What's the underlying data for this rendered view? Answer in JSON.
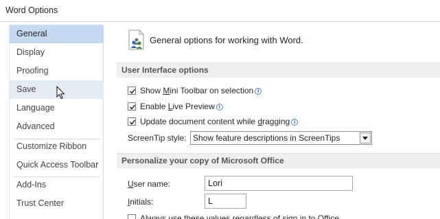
{
  "window": {
    "title": "Word Options"
  },
  "sidebar": {
    "items": [
      {
        "label": "General"
      },
      {
        "label": "Display"
      },
      {
        "label": "Proofing"
      },
      {
        "label": "Save"
      },
      {
        "label": "Language"
      },
      {
        "label": "Advanced"
      },
      {
        "label": "Customize Ribbon"
      },
      {
        "label": "Quick Access Toolbar"
      },
      {
        "label": "Add-Ins"
      },
      {
        "label": "Trust Center"
      }
    ],
    "selected": "General",
    "hovered": "Save"
  },
  "main": {
    "header": "General options for working with Word.",
    "ui_section": {
      "title": "User Interface options",
      "options": [
        {
          "pre": "Show ",
          "accel": "M",
          "post": "ini Toolbar on selection",
          "checked": true
        },
        {
          "pre": "Enable ",
          "accel": "L",
          "post": "ive Preview",
          "checked": true
        },
        {
          "pre": "Update document content while ",
          "accel": "d",
          "post": "ragging",
          "checked": true
        }
      ],
      "screentip": {
        "label": "ScreenTip style:",
        "value": "Show feature descriptions in ScreenTips"
      }
    },
    "personalize_section": {
      "title": "Personalize your copy of Microsoft Office",
      "username": {
        "pre": "",
        "accel": "U",
        "post": "ser name:",
        "value": "Lori"
      },
      "initials": {
        "pre": "",
        "accel": "I",
        "post": "nitials:",
        "value": "L"
      },
      "always_use": {
        "text": "Always use these values regardless of sign in to Office.",
        "checked": false
      }
    }
  },
  "colors": {
    "selected_nav": "#c5d9f1",
    "hover_nav": "#e4ebf5",
    "section_bar": "#efefef",
    "info_icon": "#4a7fc1"
  },
  "icons": [
    "options-people-icon",
    "checkmark-icon",
    "info-icon",
    "dropdown-arrow-icon",
    "mouse-pointer-icon"
  ]
}
